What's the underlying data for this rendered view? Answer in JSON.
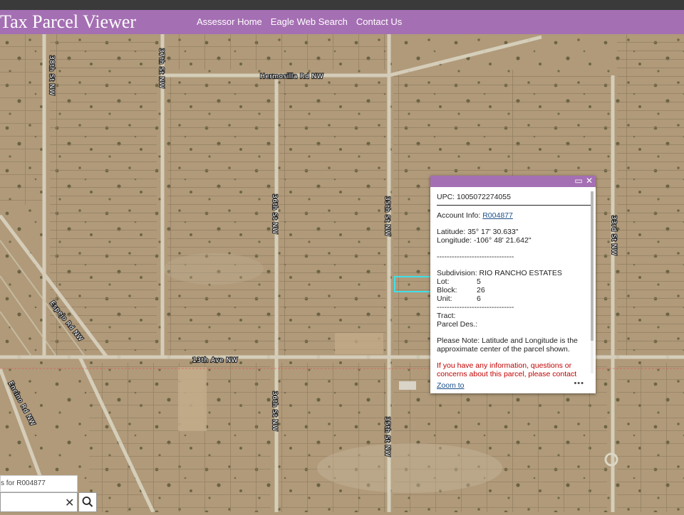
{
  "header": {
    "title": "Tax Parcel Viewer",
    "nav": [
      "Assessor Home",
      "Eagle Web Search",
      "Contact Us"
    ]
  },
  "map": {
    "road_labels": [
      "38th St NW",
      "37th St NW",
      "Hermosilla Rd NW",
      "36th St NW",
      "35th St NW",
      "33rd St NW",
      "Espejo Rd NW",
      "13th Ave NW",
      "Encino Rd NW"
    ]
  },
  "popup": {
    "upc_label": "UPC:",
    "upc": "1005072274055",
    "account_label": "Account Info:",
    "account": "R004877",
    "latitude_label": "Latitude:",
    "latitude": "35° 17' 30.633\"",
    "longitude_label": "Longitude:",
    "longitude": "-106° 48' 21.642\"",
    "separator": "-------------------------------",
    "subdivision_label": "Subdivision:",
    "subdivision": "RIO RANCHO ESTATES",
    "lot_label": "Lot:",
    "lot": "5",
    "block_label": "Block:",
    "block": "26",
    "unit_label": "Unit:",
    "unit": "6",
    "tract_label": "Tract:",
    "parcel_des_label": "Parcel Des.:",
    "note": "Please Note: Latitude and Longitude is the approximate center of the parcel shown.",
    "info_text": "If you have any information, questions or concerns about this parcel, please contact",
    "zoom_label": "Zoom to",
    "more": "•••"
  },
  "search": {
    "tip": "s for R004877",
    "clear": "✕"
  },
  "colors": {
    "header": "#a56fb3",
    "terrain": "#b09a7a",
    "road": "#dcd7c4",
    "selection": "#3fe0ea",
    "link": "#1a4f8a",
    "warning": "#c00000"
  }
}
